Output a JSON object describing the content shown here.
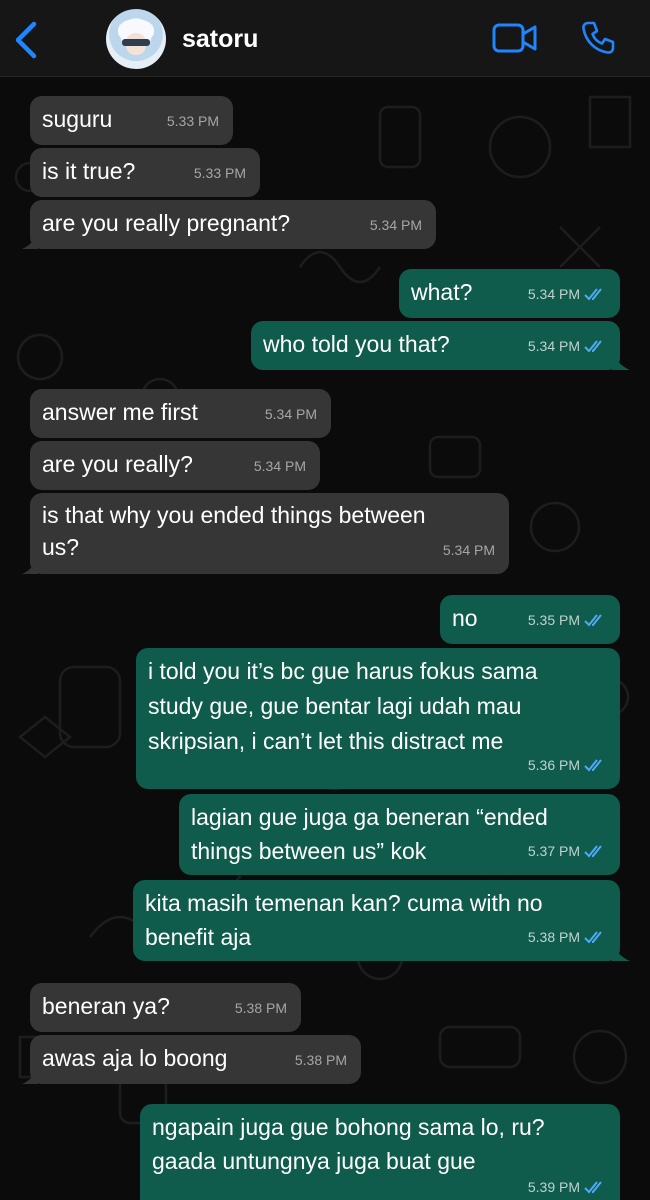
{
  "header": {
    "contact_name": "satoru",
    "back_icon": "chevron-left-icon",
    "video_icon": "video-camera-icon",
    "call_icon": "phone-icon",
    "accent_color": "#1e86ff"
  },
  "messages": [
    {
      "dir": "in",
      "text": "suguru",
      "time": "5.33 PM"
    },
    {
      "dir": "in",
      "text": "is it true?",
      "time": "5.33 PM"
    },
    {
      "dir": "in",
      "text": "are you really pregnant?",
      "time": "5.34 PM"
    },
    {
      "dir": "out",
      "text": "what?",
      "time": "5.34 PM",
      "status": "read"
    },
    {
      "dir": "out",
      "text": "who told you that?",
      "time": "5.34 PM",
      "status": "read"
    },
    {
      "dir": "in",
      "text": "answer me first",
      "time": "5.34 PM"
    },
    {
      "dir": "in",
      "text": "are you really?",
      "time": "5.34 PM"
    },
    {
      "dir": "in",
      "text": "is that why you ended things between\nus?",
      "time": "5.34 PM"
    },
    {
      "dir": "out",
      "text": "no",
      "time": "5.35 PM",
      "status": "read"
    },
    {
      "dir": "out",
      "text": "i told you it’s bc gue harus fokus sama\nstudy gue, gue bentar lagi udah mau\nskripsian, i can’t let this distract me",
      "time": "5.36 PM",
      "status": "read"
    },
    {
      "dir": "out",
      "text": "lagian gue juga ga beneran “ended\nthings between us” kok",
      "time": "5.37 PM",
      "status": "read"
    },
    {
      "dir": "out",
      "text": "kita masih temenan kan? cuma with no\nbenefit aja",
      "time": "5.38 PM",
      "status": "read"
    },
    {
      "dir": "in",
      "text": "beneran ya?",
      "time": "5.38 PM"
    },
    {
      "dir": "in",
      "text": "awas aja lo boong",
      "time": "5.38 PM"
    },
    {
      "dir": "out",
      "text": "ngapain juga gue bohong sama lo, ru?\ngaada untungnya juga buat gue",
      "time": "5.39 PM",
      "status": "read"
    }
  ]
}
